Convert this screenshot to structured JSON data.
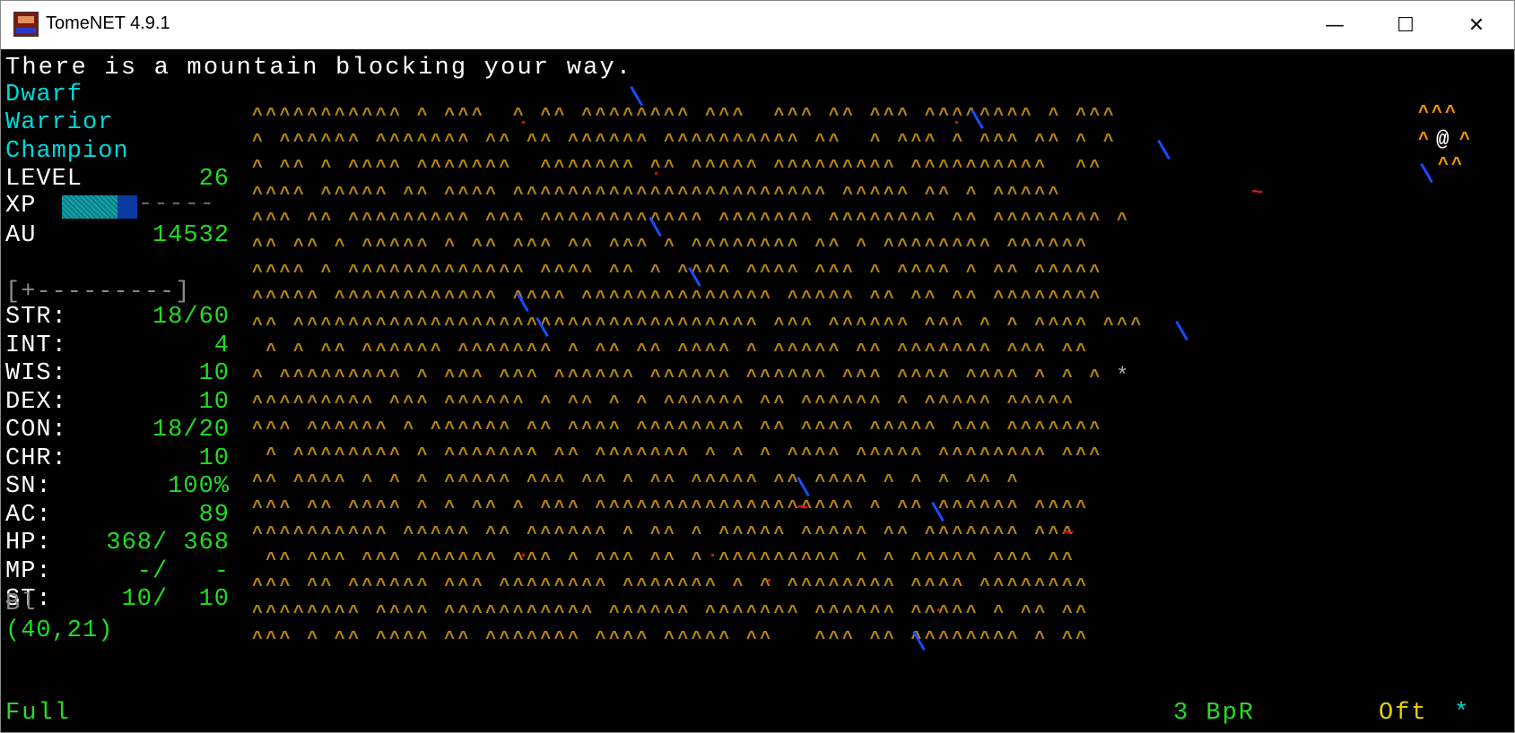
{
  "window": {
    "title": "TomeNET 4.9.1",
    "minimize_glyph": "—",
    "maximize_glyph": "☐",
    "close_glyph": "✕"
  },
  "message": "There is a mountain blocking your way.",
  "character": {
    "race": "Dwarf",
    "class": "Warrior",
    "title": "Champion",
    "level_label": "LEVEL",
    "level": "26",
    "xp_label": "XP",
    "xp_dashes": "-----",
    "au_label": "AU",
    "au": "14532",
    "depth_bar": "[+---------]",
    "stats": [
      {
        "label": "STR:",
        "value": "18/60"
      },
      {
        "label": "INT:",
        "value": "4"
      },
      {
        "label": "WIS:",
        "value": "10"
      },
      {
        "label": "DEX:",
        "value": "10"
      },
      {
        "label": "CON:",
        "value": "18/20"
      },
      {
        "label": "CHR:",
        "value": "10"
      },
      {
        "label": "SN:",
        "value": "100%"
      },
      {
        "label": "AC:",
        "value": "89"
      },
      {
        "label": "HP:",
        "value": "368/ 368"
      },
      {
        "label": "MP:",
        "value": "-/   -"
      },
      {
        "label": "ST:",
        "value": "10/  10"
      }
    ],
    "blind_label": "Bl",
    "coords": "(40,21)"
  },
  "status_bar": {
    "hunger": "Full",
    "blows": "3 BpR",
    "mode": "Oft",
    "indicator": "*"
  },
  "map_rows": [
    "^^^^^^^^^^^ ^ ^^^  ^ ^^ ^^^^^^^^ ^^^  ^^^ ^^ ^^^ ^^^^^^^^ ^ ^^^",
    "^ ^^^^^^ ^^^^^^^ ^^ ^^ ^^^^^^ ^^^^^^^^^^ ^^  ^ ^^^ ^ ^^^ ^^ ^ ^",
    "^ ^^ ^ ^^^^ ^^^^^^^  ^^^^^^^ ^^ ^^^^^ ^^^^^^^^^ ^^^^^^^^^^  ^^",
    "^^^^ ^^^^^ ^^ ^^^^ ^^^^^^^^^^^^^^^^^^^^^^^ ^^^^^ ^^ ^ ^^^^^",
    "^^^ ^^ ^^^^^^^^^ ^^^ ^^^^^^^^^^^^ ^^^^^^^ ^^^^^^^^ ^^ ^^^^^^^^ ^",
    "^^ ^^ ^ ^^^^^ ^ ^^ ^^^ ^^ ^^^ ^ ^^^^^^^^ ^^ ^ ^^^^^^^^ ^^^^^^",
    "^^^^ ^ ^^^^^^^^^^^^^ ^^^^ ^^ ^ ^^^^ ^^^^ ^^^ ^ ^^^^ ^ ^^ ^^^^^",
    "^^^^^ ^^^^^^^^^^^^ ^^^^ ^^^^^^^^^^^^^^ ^^^^^ ^^ ^^ ^^ ^^^^^^^^",
    "^^ ^^^^^^^^^^^^^^^^^^^^^^^^^^^^^^^^^^ ^^^ ^^^^^^ ^^^ ^ ^ ^^^^ ^^^",
    " ^ ^ ^^ ^^^^^^ ^^^^^^^ ^ ^^ ^^ ^^^^ ^ ^^^^^ ^^ ^^^^^^^ ^^^ ^^",
    "^ ^^^^^^^^^ ^ ^^^ ^^^ ^^^^^^ ^^^^^^ ^^^^^^ ^^^ ^^^^ ^^^^ ^ ^ ^",
    "^^^^^^^^^ ^^^ ^^^^^^ ^ ^^ ^ ^ ^^^^^^ ^^ ^^^^^^ ^ ^^^^^ ^^^^^",
    "^^^ ^^^^^^ ^ ^^^^^^ ^^ ^^^^ ^^^^^^^^ ^^ ^^^^ ^^^^^ ^^^ ^^^^^^^",
    " ^ ^^^^^^^^ ^ ^^^^^^^ ^^ ^^^^^^^ ^ ^ ^ ^^^^ ^^^^^ ^^^^^^^^ ^^^",
    "^^ ^^^^ ^ ^ ^ ^^^^^ ^^^ ^^ ^ ^^ ^^^^^ ^^ ^^^^ ^ ^ ^ ^^ ^",
    "^^^ ^^ ^^^^ ^ ^ ^^ ^ ^^^ ^^^^^^^^^^^^^^^^^^^ ^ ^^ ^^^^^^ ^^^^",
    "^^^^^^^^^^ ^^^^^ ^^ ^^^^^^ ^ ^^ ^ ^^^^^ ^^^^^ ^^ ^^^^^^^ ^^^",
    " ^^ ^^^ ^^^ ^^^^^^ ^^^ ^ ^^^ ^^ ^ ^^^^^^^^^ ^ ^ ^^^^^ ^^^ ^^",
    "^^^ ^^ ^^^^^^ ^^^ ^^^^^^^^ ^^^^^^^ ^ ^ ^^^^^^^^ ^^^^ ^^^^^^^^",
    "^^^^^^^^ ^^^^ ^^^^^^^^^^^ ^^^^^^ ^^^^^^^ ^^^^^^ ^^^^^ ^ ^^ ^^",
    "^^^ ^ ^^ ^^^^ ^^ ^^^^^^^ ^^^^ ^^^^^ ^^   ^^^ ^^ ^^^^^^^^ ^ ^^"
  ],
  "colors": {
    "mountain": "#b8860b",
    "highlight": "#ff9900",
    "text_cyan": "#00d8d8",
    "text_green": "#22dd22",
    "tree": "#1a4bff",
    "hazard": "#e01818"
  },
  "glyphs": {
    "player": "@",
    "monster": "~",
    "rubble": "*",
    "highlight_top": "^^^",
    "highlight_mid_left": "^",
    "highlight_mid_right": "^",
    "highlight_bottom": "^^"
  }
}
